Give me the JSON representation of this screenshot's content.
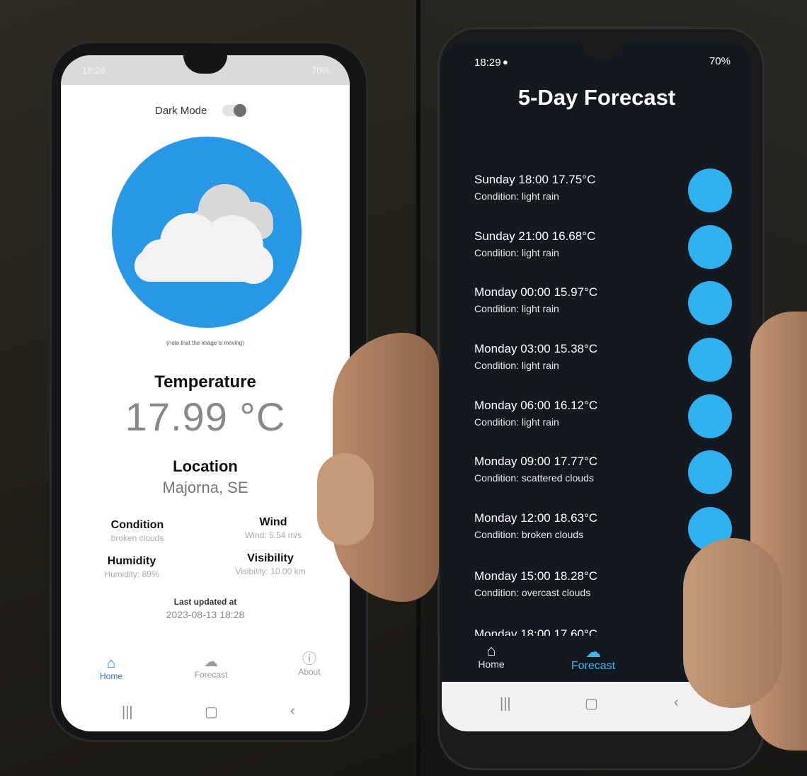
{
  "left_phone": {
    "status": {
      "time": "18:28",
      "battery": "70%"
    },
    "dark_mode_label": "Dark Mode",
    "note": "(note that the image is moving)",
    "temperature": {
      "label": "Temperature",
      "value": "17.99 °C"
    },
    "location": {
      "label": "Location",
      "value": "Majorna, SE"
    },
    "condition": {
      "label": "Condition",
      "value": "broken clouds"
    },
    "wind": {
      "label": "Wind",
      "value": "Wind: 5.54 m/s"
    },
    "humidity": {
      "label": "Humidity",
      "value": "Humidity: 89%"
    },
    "visibility": {
      "label": "Visibility",
      "value": "Visibility: 10.00 km"
    },
    "last_updated": {
      "label": "Last updated at",
      "value": "2023-08-13 18:28"
    },
    "nav": {
      "home": "Home",
      "forecast": "Forecast",
      "about": "About"
    },
    "colors": {
      "accent": "#2897e6",
      "nav_active": "#2a6fe0",
      "nav_inactive": "#9a9a9a"
    }
  },
  "right_phone": {
    "status": {
      "time": "18:29",
      "battery": "70%"
    },
    "title": "5-Day Forecast",
    "forecast": [
      {
        "line1": "Sunday 18:00 17.75°C",
        "line2": "Condition: light rain"
      },
      {
        "line1": "Sunday 21:00 16.68°C",
        "line2": "Condition: light rain"
      },
      {
        "line1": "Monday 00:00 15.97°C",
        "line2": "Condition: light rain"
      },
      {
        "line1": "Monday 03:00 15.38°C",
        "line2": "Condition: light rain"
      },
      {
        "line1": "Monday 06:00 16.12°C",
        "line2": "Condition: light rain"
      },
      {
        "line1": "Monday 09:00 17.77°C",
        "line2": "Condition: scattered clouds"
      },
      {
        "line1": "Monday 12:00 18.63°C",
        "line2": "Condition: broken clouds"
      },
      {
        "line1": "Monday 15:00 18.28°C",
        "line2": "Condition: overcast clouds"
      },
      {
        "line1": "Monday 18:00 17.60°C",
        "line2": ""
      }
    ],
    "nav": {
      "home": "Home",
      "forecast": "Forecast"
    },
    "colors": {
      "accent": "#2fb0ef",
      "nav_active": "#3ab6f2",
      "background": "#14181f"
    }
  }
}
